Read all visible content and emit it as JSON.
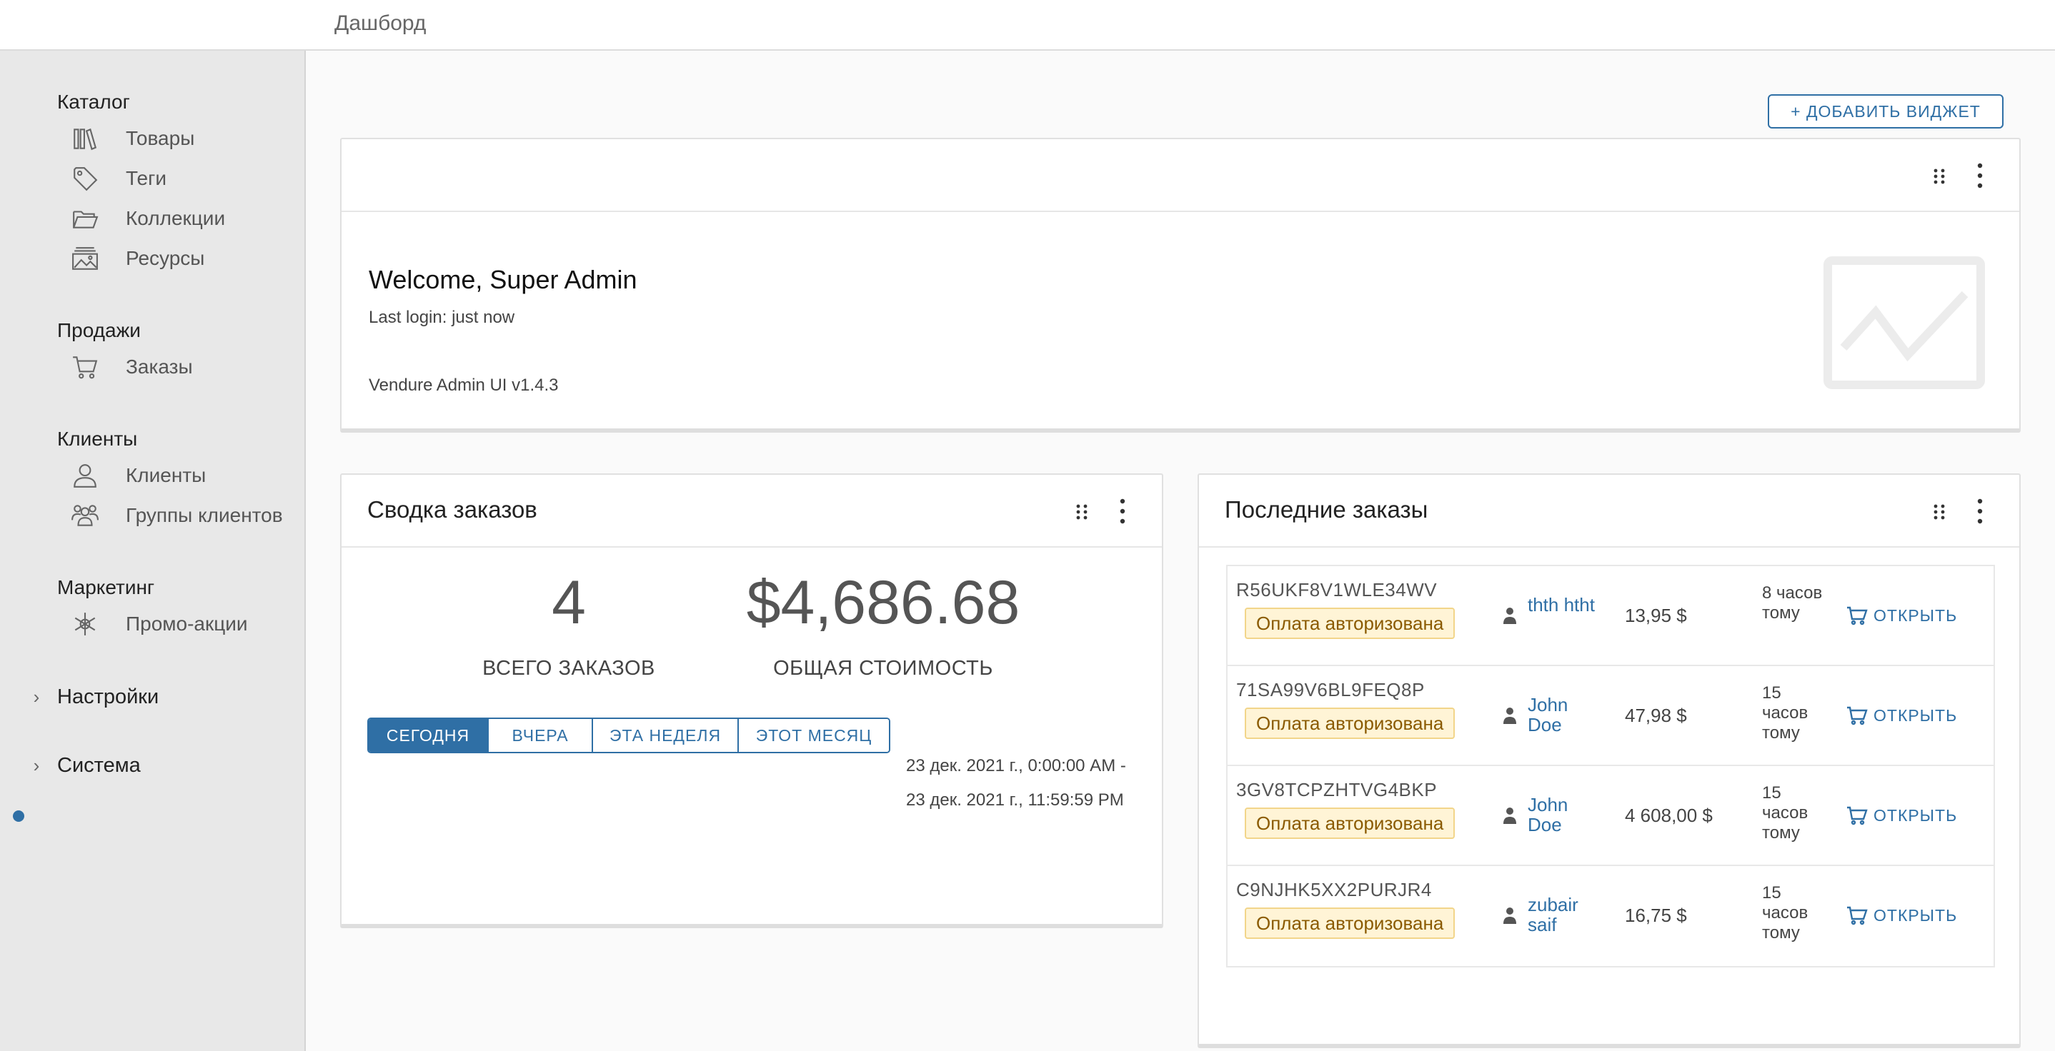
{
  "header": {
    "breadcrumb": "Дашборд"
  },
  "sidebar": {
    "sections": [
      {
        "title": "Каталог",
        "items": [
          {
            "label": "Товары",
            "icon": "library-icon"
          },
          {
            "label": "Теги",
            "icon": "tag-icon"
          },
          {
            "label": "Коллекции",
            "icon": "folder-open-icon"
          },
          {
            "label": "Ресурсы",
            "icon": "images-icon"
          }
        ]
      },
      {
        "title": "Продажи",
        "items": [
          {
            "label": "Заказы",
            "icon": "shopping-cart-icon"
          }
        ]
      },
      {
        "title": "Клиенты",
        "items": [
          {
            "label": "Клиенты",
            "icon": "user-icon"
          },
          {
            "label": "Группы клиентов",
            "icon": "users-icon"
          }
        ]
      },
      {
        "title": "Маркетинг",
        "items": [
          {
            "label": "Промо-акции",
            "icon": "asterisk-icon"
          }
        ]
      }
    ],
    "collapsibles": [
      {
        "label": "Настройки",
        "icon": "chevron-right-icon"
      },
      {
        "label": "Система",
        "icon": "chevron-right-icon",
        "status_dot_color": "#2f6fa5"
      }
    ]
  },
  "toolbar": {
    "add_widget_label": "+ ДОБАВИТЬ ВИДЖЕТ"
  },
  "welcome": {
    "title": "Welcome, Super Admin",
    "last_login": "Last login: just now",
    "version": "Vendure Admin UI v1.4.3"
  },
  "summary": {
    "title": "Сводка заказов",
    "total_orders": "4",
    "total_orders_label": "ВСЕГО ЗАКАЗОВ",
    "total_value": "$4,686.68",
    "total_value_label": "ОБЩАЯ СТОИМОСТЬ",
    "tabs": [
      "СЕГОДНЯ",
      "ВЧЕРА",
      "ЭТА НЕДЕЛЯ",
      "ЭТОТ МЕСЯЦ"
    ],
    "active_tab": "СЕГОДНЯ",
    "range": "23 дек. 2021 г., 0:00:00 AM - 23 дек. 2021 г., 11:59:59 PM"
  },
  "latest": {
    "title": "Последние заказы",
    "open_label": "ОТКРЫТЬ",
    "orders": [
      {
        "code": "R56UKF8V1WLE34WV",
        "status": "Оплата авторизована",
        "customer": "thth htht",
        "total": "13,95 $",
        "time": "8 часов тому"
      },
      {
        "code": "71SA99V6BL9FEQ8P",
        "status": "Оплата авторизована",
        "customer": "John Doe",
        "total": "47,98 $",
        "time": "15 часов тому"
      },
      {
        "code": "3GV8TCPZHTVG4BKP",
        "status": "Оплата авторизована",
        "customer": "John Doe",
        "total": "4 608,00 $",
        "time": "15 часов тому"
      },
      {
        "code": "C9NJHK5XX2PURJR4",
        "status": "Оплата авторизована",
        "customer": "zubair saif",
        "total": "16,75 $",
        "time": "15 часов тому"
      }
    ]
  },
  "colors": {
    "accent": "#2f6fa5",
    "badge_bg": "#fff4d6",
    "badge_text": "#8a5a00",
    "sidebar_bg": "#e8e8e8"
  }
}
